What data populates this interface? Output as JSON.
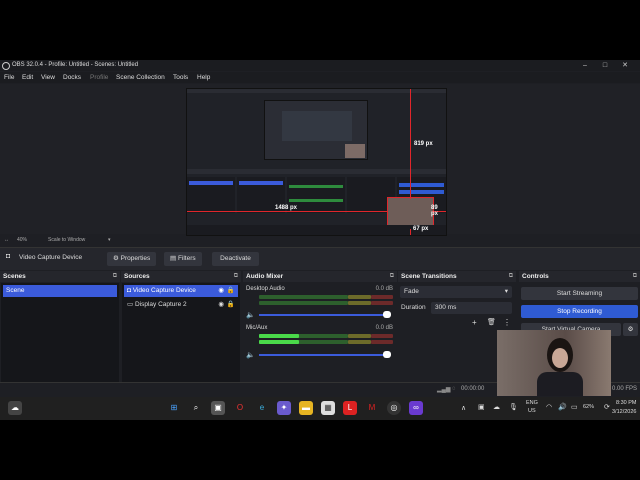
{
  "window": {
    "title": "OBS 32.0.4 - Profile: Untitled - Scenes: Untitled",
    "minimize": "–",
    "maximize": "□",
    "close": "✕"
  },
  "menu": [
    "File",
    "Edit",
    "View",
    "Docks",
    "Profile",
    "Scene Collection",
    "Tools",
    "Help"
  ],
  "preview": {
    "label_top": "819 px",
    "label_left": "1488 px",
    "label_right": "89 px",
    "label_bottom": "67 px"
  },
  "zoom": {
    "level": "40%",
    "scale": "Scale to Window"
  },
  "source_toolbar": {
    "source": "Video Capture Device",
    "properties": "Properties",
    "filters": "Filters",
    "deactivate": "Deactivate"
  },
  "scenes": {
    "title": "Scenes",
    "items": [
      "Scene"
    ]
  },
  "sources": {
    "title": "Sources",
    "items": [
      "Video Capture Device",
      "Display Capture 2"
    ]
  },
  "mixer": {
    "title": "Audio Mixer",
    "channels": [
      {
        "name": "Desktop Audio",
        "db": "0.0 dB",
        "level": 0.0
      },
      {
        "name": "Mic/Aux",
        "db": "0.0 dB",
        "level": 0.3
      }
    ],
    "ticks": [
      "-60",
      "-55",
      "-50",
      "-45",
      "-40",
      "-35",
      "-30",
      "-25",
      "-20",
      "-15",
      "-10",
      "-5",
      "0"
    ]
  },
  "transitions": {
    "title": "Scene Transitions",
    "type": "Fade",
    "duration_label": "Duration",
    "duration": "300 ms"
  },
  "controls": {
    "title": "Controls",
    "start_streaming": "Start Streaming",
    "stop_recording": "Stop Recording",
    "start_virtual_camera": "Start Virtual Camera"
  },
  "status": {
    "time": "00:00:00",
    "fps": "0.00 FPS"
  },
  "taskbar": {
    "lang": "ENG",
    "region": "US",
    "battery": "62%",
    "clock": "8:30 PM",
    "date": "3/12/2026"
  }
}
